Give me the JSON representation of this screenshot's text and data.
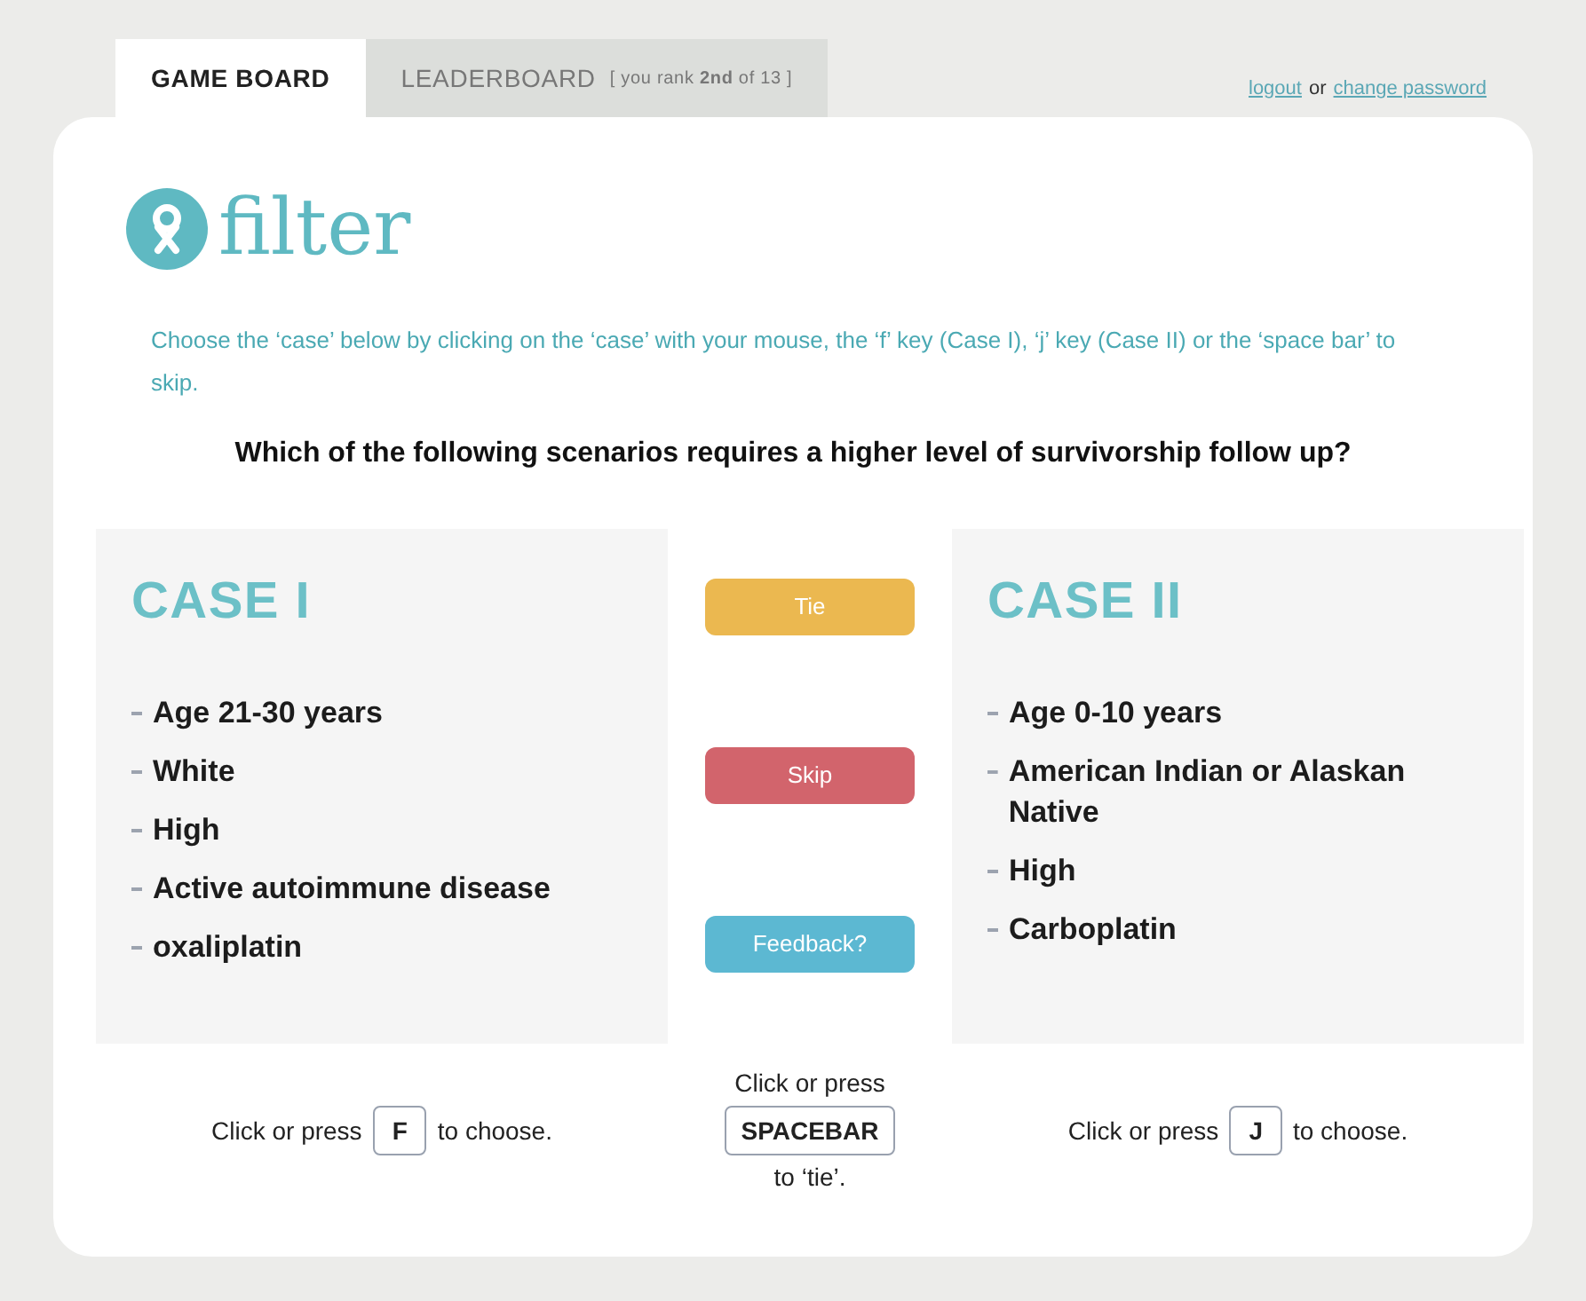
{
  "tabs": [
    {
      "label": "GAME BOARD",
      "selected": true
    },
    {
      "label": "LEADERBOARD",
      "note": "[ you rank **2nd** of 13 ]",
      "selected": false
    }
  ],
  "account_links": {
    "logout": "logout",
    "separator": "or",
    "change_password": "change password"
  },
  "logo": {
    "text": "filter"
  },
  "instructions": "Choose the ‘case’ below by clicking on the ‘case’ with your mouse, the ‘f’ key (Case I), ‘j’ key (Case II) or the ‘space bar’ to skip.",
  "question": "Which of the following scenarios requires a higher  level of survivorship follow up?",
  "cases": [
    {
      "title": "CASE I",
      "items": [
        "Age 21-30 years",
        "White",
        "High",
        "Active autoimmune disease",
        "oxaliplatin"
      ],
      "hint": {
        "before": "Click or press",
        "key": "F",
        "after": "to choose."
      }
    },
    {
      "title": "CASE II",
      "items": [
        "Age 0-10 years",
        "American Indian or Alaskan Native",
        "High",
        "Carboplatin"
      ],
      "hint": {
        "before": "Click or press",
        "key": "J",
        "after": "to choose."
      }
    }
  ],
  "actions": [
    {
      "label": "Tie",
      "color": "#ebb850"
    },
    {
      "label": "Skip",
      "color": "#d2646c"
    },
    {
      "label": "Feedback?",
      "color": "#5cb8d2"
    }
  ],
  "center_hint": {
    "before": "Click or press",
    "key": "SPACEBAR",
    "after": "to ‘tie’."
  }
}
